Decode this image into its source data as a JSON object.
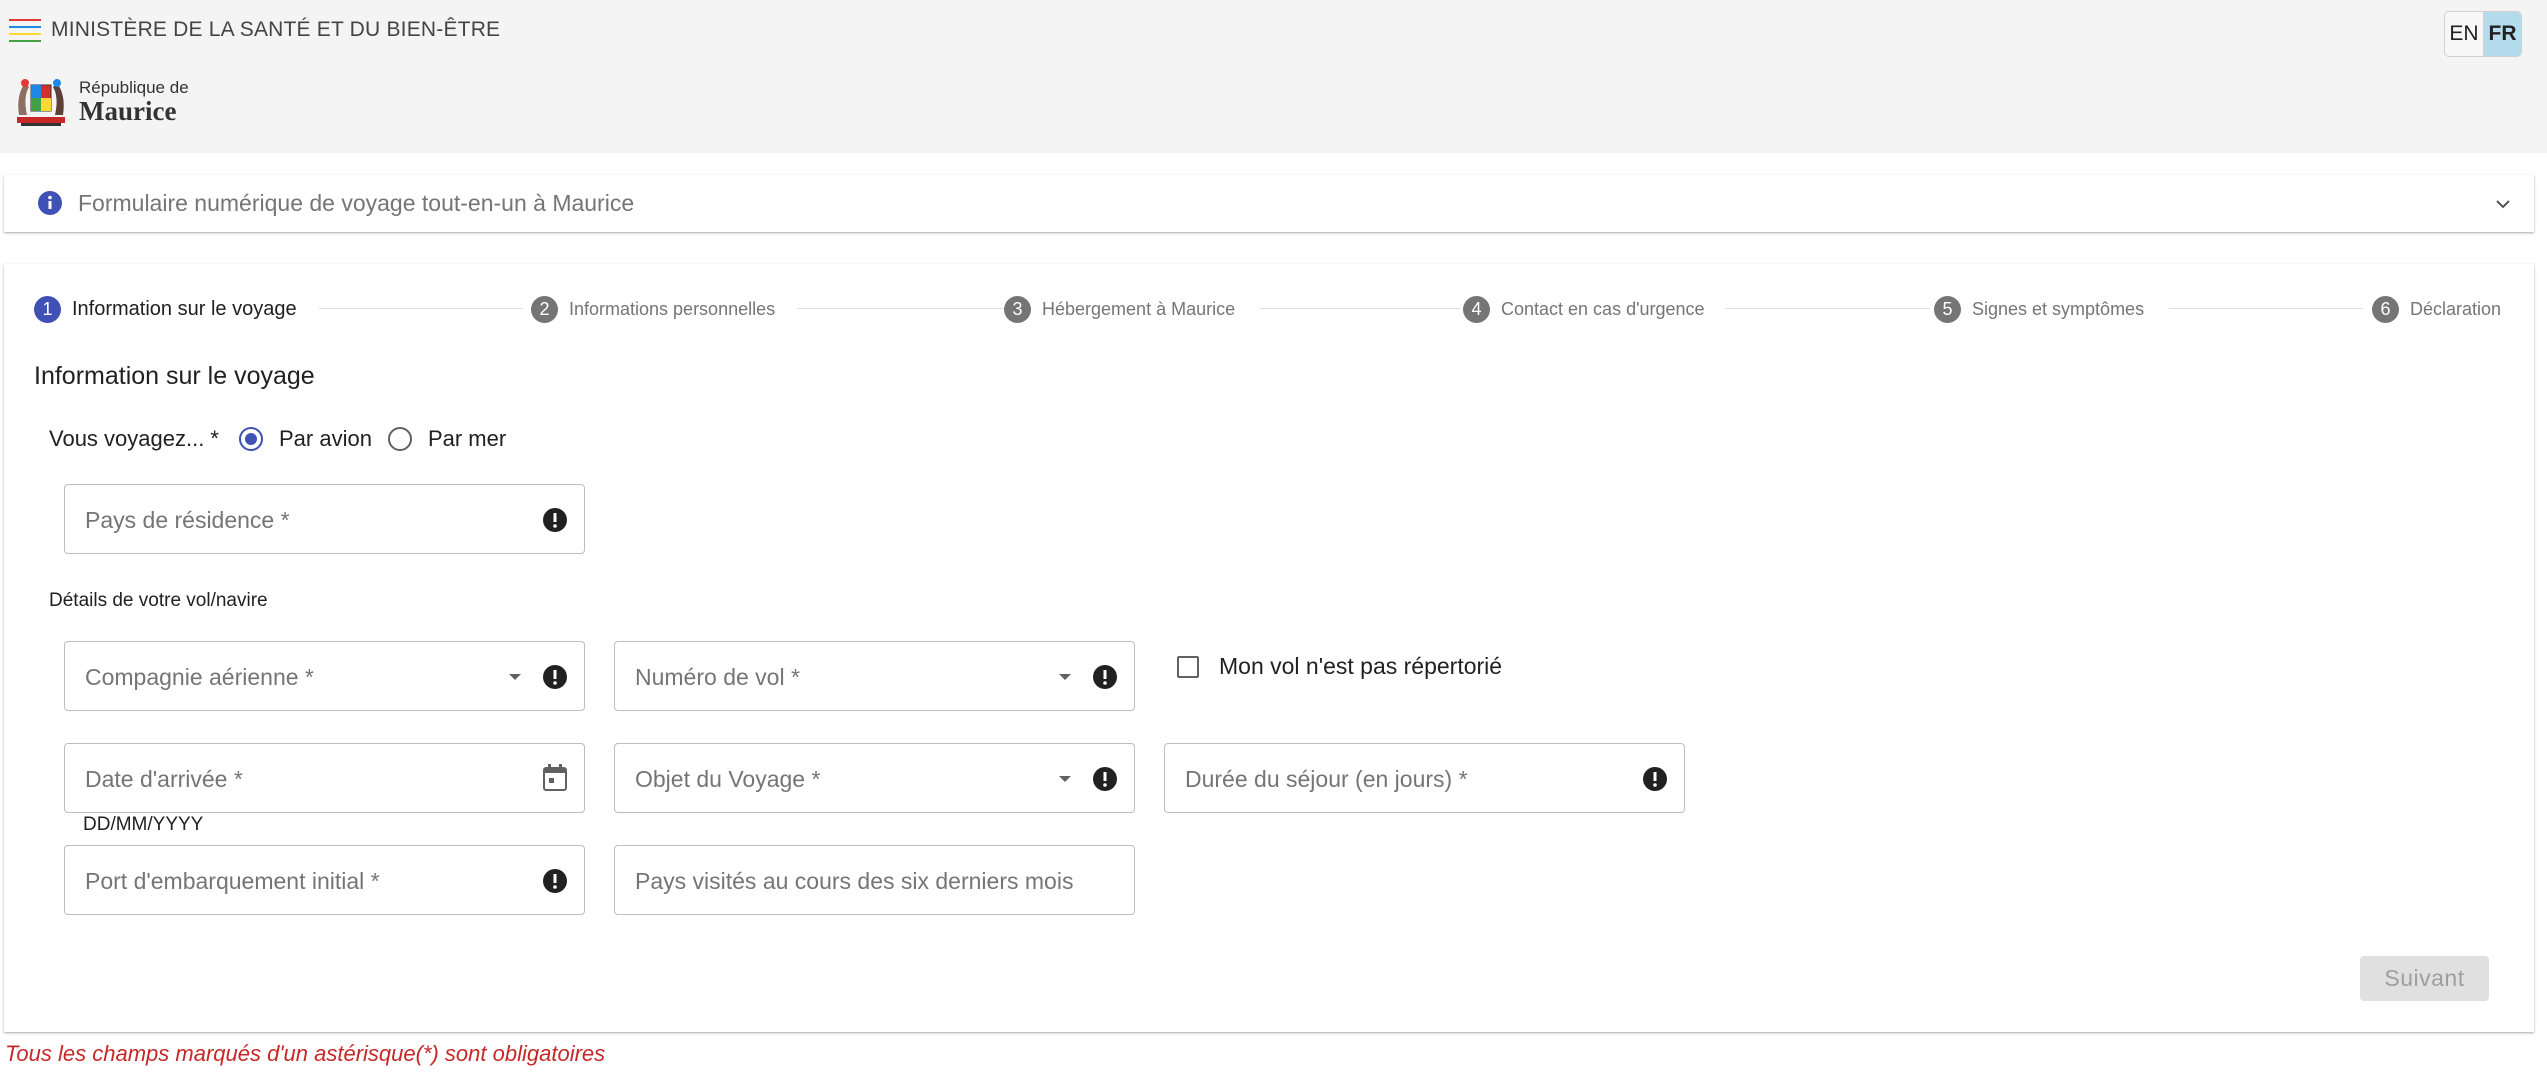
{
  "header": {
    "ministry": "MINISTÈRE DE LA SANTÉ ET DU BIEN-ÊTRE",
    "logo_line1": "République de",
    "logo_line2": "Maurice",
    "languages": [
      {
        "label": "EN",
        "active": false
      },
      {
        "label": "FR",
        "active": true
      }
    ],
    "hamburger_colors": [
      "#e53935",
      "#1e88e5",
      "#fdd835",
      "#43a047"
    ]
  },
  "accordion": {
    "title": "Formulaire numérique de voyage tout-en-un à Maurice",
    "icon": "info-icon",
    "icon_color": "#3f51b5"
  },
  "stepper": {
    "steps": [
      {
        "num": "1",
        "label": "Information sur le voyage",
        "active": true
      },
      {
        "num": "2",
        "label": "Informations personnelles",
        "active": false
      },
      {
        "num": "3",
        "label": "Hébergement à Maurice",
        "active": false
      },
      {
        "num": "4",
        "label": "Contact en cas d'urgence",
        "active": false
      },
      {
        "num": "5",
        "label": "Signes et symptômes",
        "active": false
      },
      {
        "num": "6",
        "label": "Déclaration",
        "active": false
      }
    ]
  },
  "form": {
    "section_title": "Information sur le voyage",
    "travel_question": "Vous voyagez... *",
    "travel_options": [
      {
        "label": "Par avion",
        "checked": true
      },
      {
        "label": "Par mer",
        "checked": false
      }
    ],
    "country_of_residence": {
      "placeholder": "Pays de résidence *",
      "value": ""
    },
    "details_label": "Détails de votre vol/navire",
    "airline": {
      "placeholder": "Compagnie aérienne *",
      "value": ""
    },
    "flight_number": {
      "placeholder": "Numéro de vol *",
      "value": ""
    },
    "flight_not_listed": {
      "label": "Mon vol n'est pas répertorié",
      "checked": false
    },
    "arrival_date": {
      "placeholder": "Date d'arrivée *",
      "value": "",
      "hint": "DD/MM/YYYY"
    },
    "purpose": {
      "placeholder": "Objet du Voyage *",
      "value": ""
    },
    "stay_duration": {
      "placeholder": "Durée du séjour (en jours) *",
      "value": ""
    },
    "port_of_embarkation": {
      "placeholder": "Port d'embarquement initial *",
      "value": ""
    },
    "countries_visited": {
      "placeholder": "Pays visités au cours des six derniers mois",
      "value": ""
    },
    "next_button": "Suivant"
  },
  "footer_note": "Tous les champs marqués d'un astérisque(*) sont obligatoires",
  "colors": {
    "primary": "#3f51b5",
    "error_note": "#c62828",
    "lang_active": "#b4dcec"
  }
}
